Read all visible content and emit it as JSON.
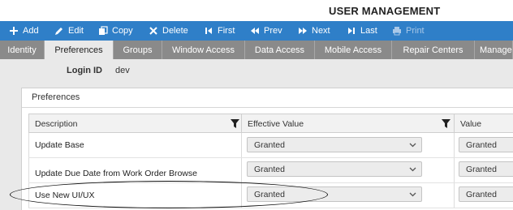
{
  "app": {
    "title": "USER MANAGEMENT"
  },
  "toolbar": {
    "add": "Add",
    "edit": "Edit",
    "copy": "Copy",
    "delete": "Delete",
    "first": "First",
    "prev": "Prev",
    "next": "Next",
    "last": "Last",
    "print": "Print"
  },
  "tabs": [
    {
      "label": "Identity"
    },
    {
      "label": "Preferences",
      "active": true
    },
    {
      "label": "Groups"
    },
    {
      "label": "Window Access"
    },
    {
      "label": "Data Access"
    },
    {
      "label": "Mobile Access"
    },
    {
      "label": "Repair Centers"
    },
    {
      "label": "Managed"
    }
  ],
  "login": {
    "label": "Login ID",
    "value": "dev"
  },
  "panel": {
    "title": "Preferences"
  },
  "grid": {
    "columns": [
      "Description",
      "Effective Value",
      "Value"
    ],
    "rows": [
      {
        "description": "Update Base",
        "effective": "Granted",
        "value": "Granted"
      },
      {
        "description": "Update Due Date from Work Order Browse",
        "effective": "Granted",
        "value": "Granted"
      },
      {
        "description": "Use New UI/UX",
        "effective": "Granted",
        "value": "Granted"
      }
    ]
  },
  "colors": {
    "toolbar": "#2f7fc8",
    "tabs": "#8a8a8a",
    "active_tab": "#e9e9e9"
  },
  "icons": [
    "plus-icon",
    "pencil-icon",
    "copy-icon",
    "delete-icon",
    "first-icon",
    "prev-icon",
    "next-icon",
    "last-icon",
    "print-icon",
    "filter-icon",
    "chevron-down-icon"
  ]
}
